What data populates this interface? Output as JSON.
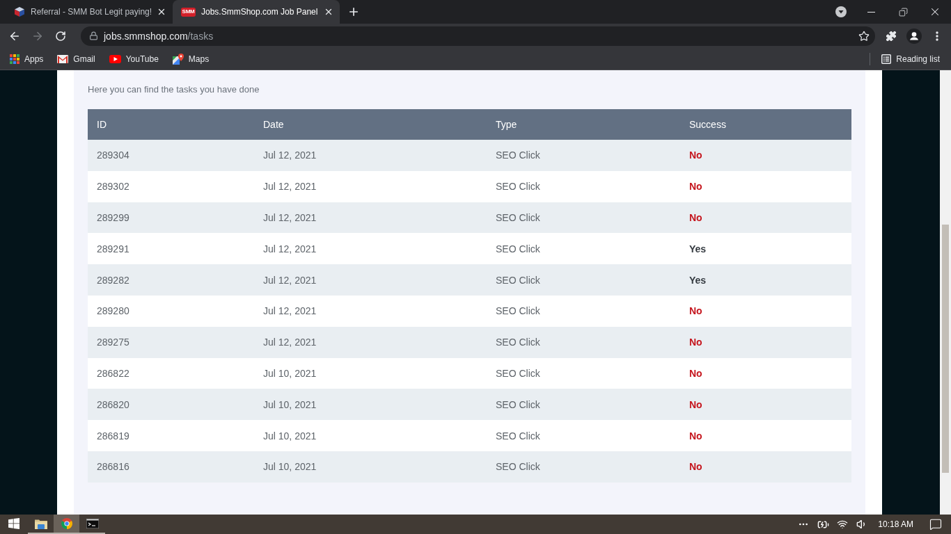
{
  "browser": {
    "tabs": [
      {
        "kind": "cube",
        "title": "Referral - SMM Bot Legit paying!",
        "selected": false
      },
      {
        "kind": "logo",
        "logo_text": "SMM",
        "title": "Jobs.SmmShop.com Job Panel",
        "selected": true
      }
    ],
    "nav": [
      {
        "kind": "back",
        "disabled": false
      },
      {
        "kind": "forward",
        "disabled": true
      },
      {
        "kind": "reload",
        "disabled": false
      }
    ],
    "url": {
      "host": "jobs.smmshop.com",
      "path": "/tasks"
    },
    "bookmarks": [
      {
        "kind": "apps",
        "label": "Apps"
      },
      {
        "kind": "gmail",
        "label": "Gmail"
      },
      {
        "kind": "youtube",
        "label": "YouTube"
      },
      {
        "kind": "maps",
        "label": "Maps"
      }
    ],
    "reading_list": "Reading list"
  },
  "page": {
    "subtitle": "Here you can find the tasks you have done",
    "table": {
      "columns": [
        "ID",
        "Date",
        "Type",
        "Success"
      ],
      "rows": [
        {
          "id": "289304",
          "date": "Jul 12, 2021",
          "type": "SEO Click",
          "success": "No",
          "succeeded": false
        },
        {
          "id": "289302",
          "date": "Jul 12, 2021",
          "type": "SEO Click",
          "success": "No",
          "succeeded": false
        },
        {
          "id": "289299",
          "date": "Jul 12, 2021",
          "type": "SEO Click",
          "success": "No",
          "succeeded": false
        },
        {
          "id": "289291",
          "date": "Jul 12, 2021",
          "type": "SEO Click",
          "success": "Yes",
          "succeeded": true
        },
        {
          "id": "289282",
          "date": "Jul 12, 2021",
          "type": "SEO Click",
          "success": "Yes",
          "succeeded": true
        },
        {
          "id": "289280",
          "date": "Jul 12, 2021",
          "type": "SEO Click",
          "success": "No",
          "succeeded": false
        },
        {
          "id": "289275",
          "date": "Jul 12, 2021",
          "type": "SEO Click",
          "success": "No",
          "succeeded": false
        },
        {
          "id": "286822",
          "date": "Jul 10, 2021",
          "type": "SEO Click",
          "success": "No",
          "succeeded": false
        },
        {
          "id": "286820",
          "date": "Jul 10, 2021",
          "type": "SEO Click",
          "success": "No",
          "succeeded": false
        },
        {
          "id": "286819",
          "date": "Jul 10, 2021",
          "type": "SEO Click",
          "success": "No",
          "succeeded": false
        },
        {
          "id": "286816",
          "date": "Jul 10, 2021",
          "type": "SEO Click",
          "success": "No",
          "succeeded": false
        }
      ]
    }
  },
  "taskbar": {
    "apps": [
      {
        "kind": "explorer",
        "open": true,
        "selected": false
      },
      {
        "kind": "browser",
        "open": true,
        "selected": true
      },
      {
        "kind": "terminal",
        "open": true,
        "selected": false
      }
    ],
    "time": "10:18 AM"
  }
}
